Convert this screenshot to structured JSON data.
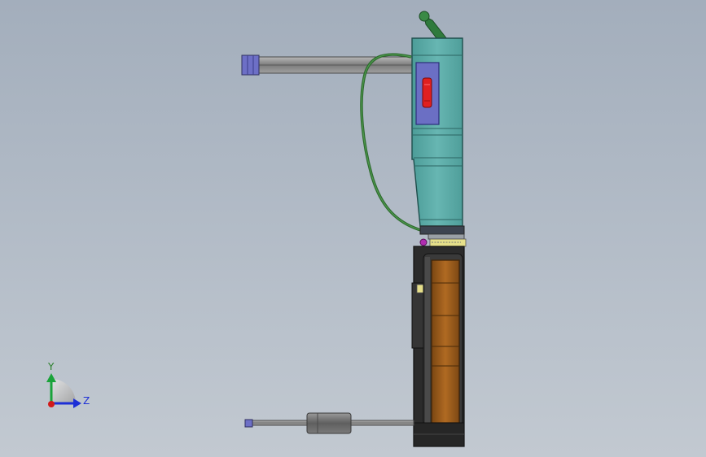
{
  "viewport": {
    "triad": {
      "y_label": "Y",
      "z_label": "Z",
      "y_color": "#1aa33a",
      "z_color": "#1d2fd6",
      "origin_color": "#d11a1a",
      "label_color": "#2a7f2a",
      "z_label_color": "#1d2fd6"
    },
    "colors": {
      "background_top": "#a3aebc",
      "body_teal": "#5aa8a4",
      "window_purple": "#6b6fc4",
      "switch_red": "#e02020",
      "cable_green": "#2e6a2e",
      "rod_gray": "#8a8a8a",
      "slide_brown": "#a4621e",
      "frame_dark": "#2a2a2a"
    },
    "icons": [
      "axis-triad-icon"
    ]
  }
}
